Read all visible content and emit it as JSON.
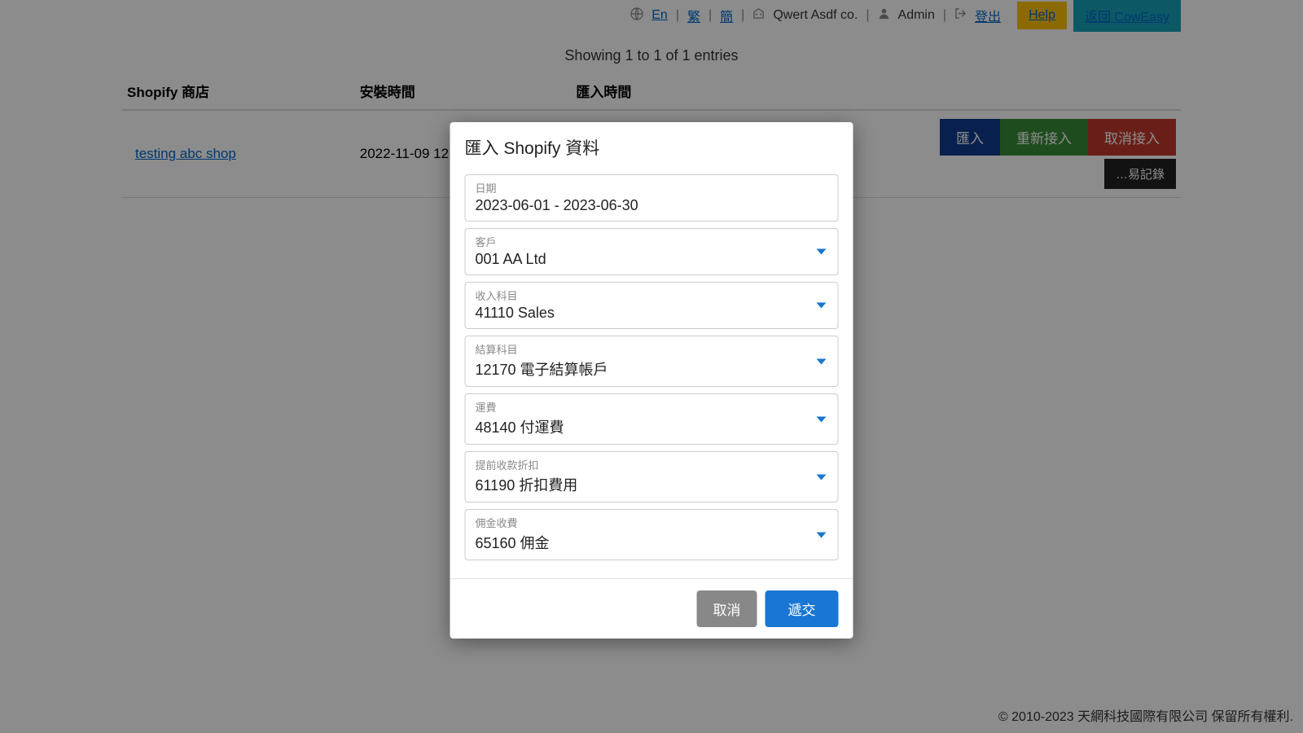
{
  "header": {
    "lang_en": "En",
    "lang_trad": "繁",
    "lang_simp": "簡",
    "company": "Qwert Asdf co.",
    "user": "Admin",
    "logout": "登出",
    "help": "Help",
    "back": "返回 CowEasy"
  },
  "entries_info": "Showing 1 to 1 of 1 entries",
  "table": {
    "headers": {
      "shop": "Shopify 商店",
      "install_time": "安裝時間",
      "import_time": "匯入時間",
      "actions": ""
    },
    "rows": [
      {
        "shop": "testing abc shop",
        "install_time": "2022-11-09 12:2",
        "import_time": "",
        "import_btn": "匯入",
        "reconnect_btn": "重新接入",
        "disconnect_btn": "取消接入",
        "log_btn": "…易記錄"
      }
    ]
  },
  "modal": {
    "title": "匯入 Shopify 資料",
    "fields": {
      "date": {
        "label": "日期",
        "value": "2023-06-01 - 2023-06-30"
      },
      "customer": {
        "label": "客戶",
        "value": "001 AA Ltd"
      },
      "income": {
        "label": "收入科目",
        "value": "41110 Sales"
      },
      "settlement": {
        "label": "結算科目",
        "value": "12170 電子結算帳戶"
      },
      "freight": {
        "label": "運費",
        "value": "48140 付運費"
      },
      "discount": {
        "label": "提前收款折扣",
        "value": "61190 折扣費用"
      },
      "commission": {
        "label": "佣金收費",
        "value": "65160 佣金"
      }
    },
    "cancel": "取消",
    "submit": "遞交"
  },
  "footer": "© 2010-2023 天網科技國際有限公司 保留所有權利."
}
